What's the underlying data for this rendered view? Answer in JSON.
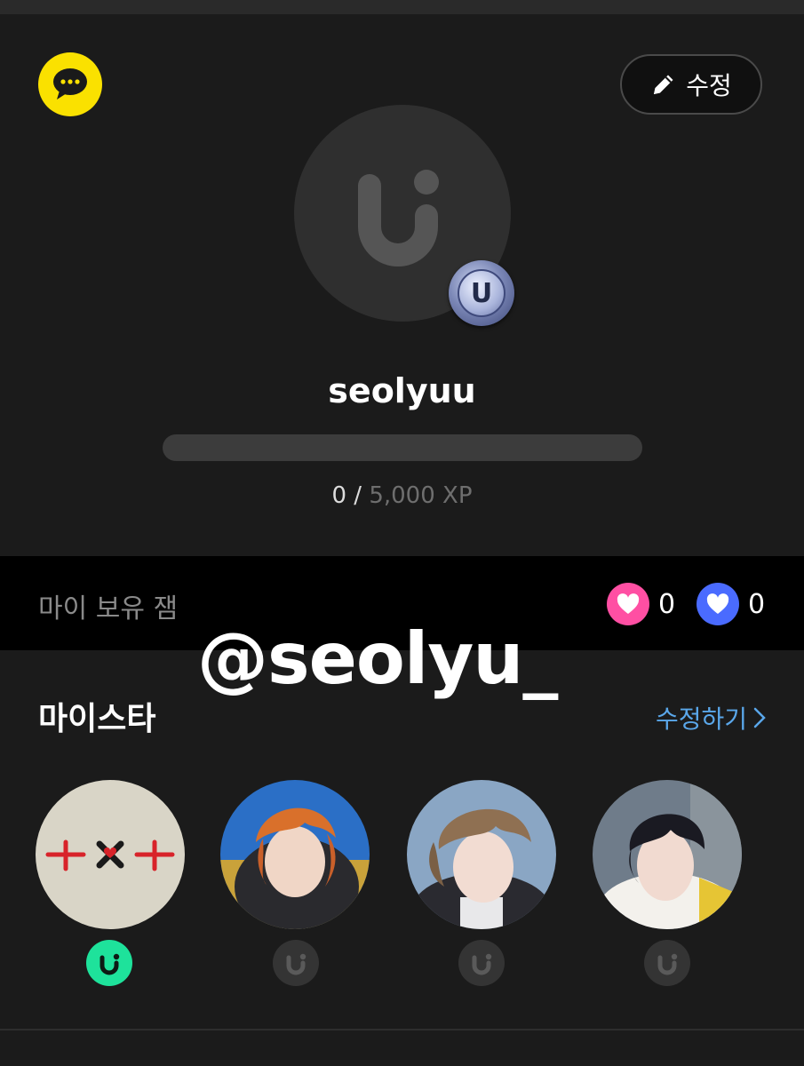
{
  "profile": {
    "edit_label": "수정",
    "username": "seolyuu",
    "level_badge_letter": "U",
    "xp": {
      "current": "0 /",
      "total": "5,000 XP",
      "progress": 0
    }
  },
  "gems": {
    "label": "마이 보유 잼",
    "pink_count": "0",
    "blue_count": "0",
    "pink_color": "#ff4fa3",
    "blue_color": "#4a6bff"
  },
  "overlay": {
    "handle": "@seolyu_"
  },
  "mystar": {
    "title": "마이스타",
    "edit_label": "수정하기",
    "stars": [
      {
        "name": "group-logo",
        "badge_active": true
      },
      {
        "name": "member-orange-hair",
        "badge_active": false
      },
      {
        "name": "member-blond-hair",
        "badge_active": false
      },
      {
        "name": "member-black-hair",
        "badge_active": false
      }
    ]
  },
  "colors": {
    "kakao": "#fae100",
    "active_badge": "#1ee29b",
    "inactive_badge": "#343434",
    "accent_link": "#5aa7ea"
  }
}
